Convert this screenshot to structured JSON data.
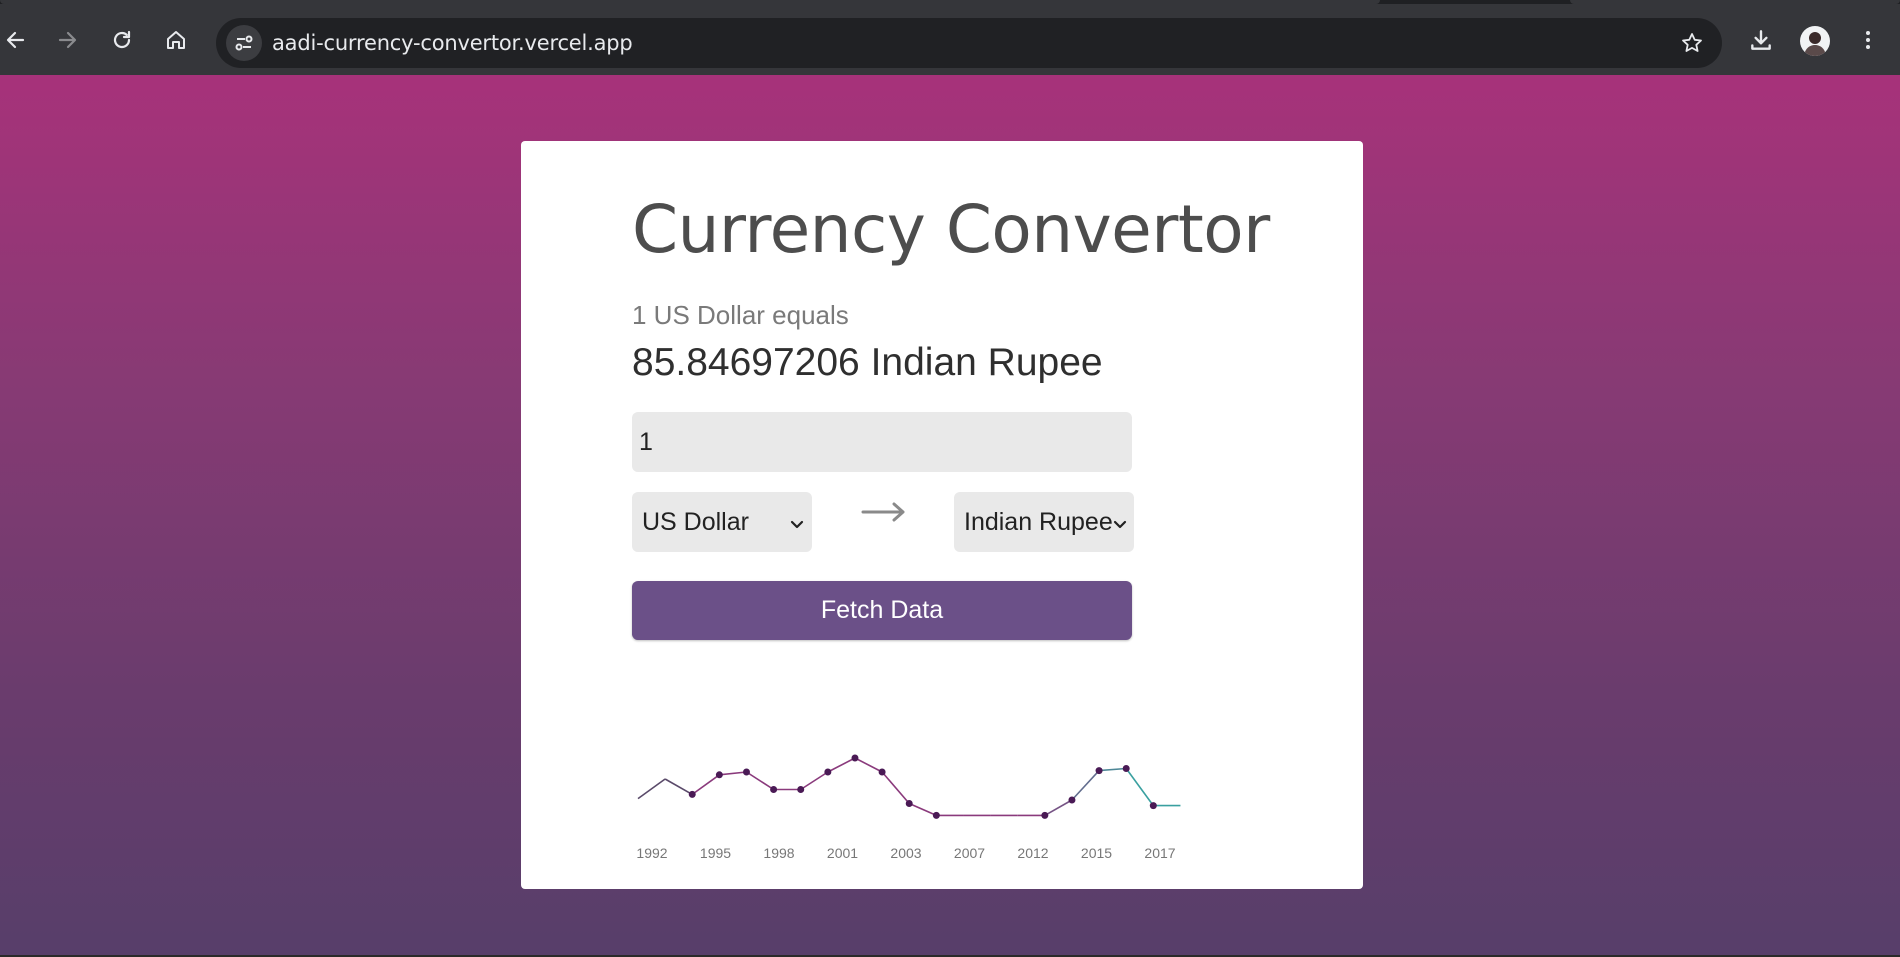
{
  "browser": {
    "url": "aadi-currency-convertor.vercel.app",
    "icons": [
      "back-icon",
      "forward-icon",
      "reload-icon",
      "home-icon",
      "site-info-icon",
      "bookmark-star-icon",
      "download-icon",
      "profile-avatar",
      "menu-dots-icon"
    ]
  },
  "app": {
    "title": "Currency Convertor",
    "equals_text": "1 US Dollar equals",
    "result_text": "85.84697206 Indian Rupee",
    "amount_value": "1",
    "from_currency": "US Dollar",
    "to_currency": "Indian Rupee",
    "fetch_label": "Fetch Data",
    "colors": {
      "background_top": "#a7327a",
      "background_bottom": "#573e6a",
      "button": "#6b5088",
      "line_purple": "#8a3a7c",
      "line_teal": "#3aa0a0",
      "point": "#4a1a55"
    }
  },
  "chart_data": {
    "type": "line",
    "title": "",
    "xlabel": "",
    "ylabel": "",
    "tick_labels": [
      "1992",
      "1995",
      "1998",
      "2001",
      "2003",
      "2007",
      "2012",
      "2015",
      "2017"
    ],
    "grid": false,
    "series": [
      {
        "values": [
          0.32,
          0.6,
          0.38,
          0.66,
          0.7,
          0.45,
          0.45,
          0.7,
          0.9,
          0.7,
          0.25,
          0.08,
          0.08,
          0.08,
          0.08,
          0.08,
          0.3,
          0.72,
          0.75,
          0.22,
          0.22
        ],
        "marked": [
          false,
          false,
          true,
          true,
          true,
          true,
          true,
          true,
          true,
          true,
          true,
          true,
          false,
          false,
          false,
          true,
          true,
          true,
          true,
          true,
          false
        ]
      }
    ]
  }
}
